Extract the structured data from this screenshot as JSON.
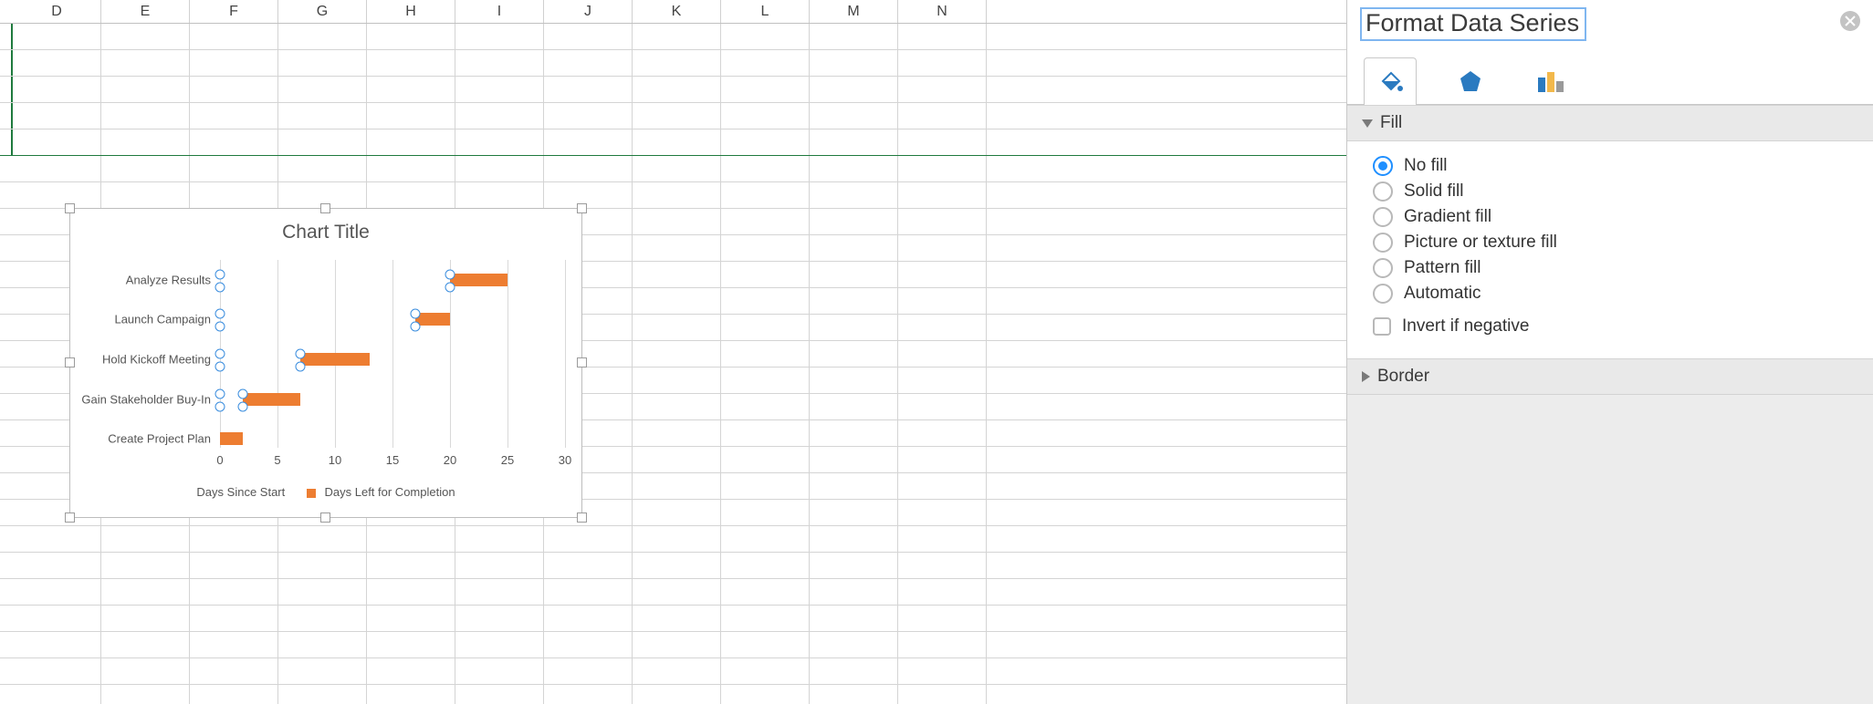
{
  "columns": [
    "D",
    "E",
    "F",
    "G",
    "H",
    "I",
    "J",
    "K",
    "L",
    "M",
    "N"
  ],
  "chart": {
    "title": "Chart Title",
    "legend": {
      "series1": "Days Since Start",
      "series2": "Days Left for Completion"
    },
    "x_ticks": [
      "0",
      "5",
      "10",
      "15",
      "20",
      "25",
      "30"
    ]
  },
  "chart_data": {
    "type": "bar",
    "orientation": "horizontal",
    "stacked": true,
    "title": "Chart Title",
    "xlabel": "",
    "ylabel": "",
    "xlim": [
      0,
      30
    ],
    "categories": [
      "Analyze Results",
      "Launch Campaign",
      "Hold Kickoff Meeting",
      "Gain Stakeholder Buy-In",
      "Create Project Plan"
    ],
    "series": [
      {
        "name": "Days Since Start",
        "values": [
          20,
          17,
          7,
          2,
          0
        ]
      },
      {
        "name": "Days Left for Completion",
        "values": [
          5,
          3,
          6,
          5,
          2
        ]
      }
    ],
    "colors": {
      "Days Since Start": "none",
      "Days Left for Completion": "#ED7D31"
    },
    "legend_position": "bottom"
  },
  "panel": {
    "title": "Format Data Series",
    "sections": {
      "fill": "Fill",
      "border": "Border"
    },
    "fill_options": {
      "no_fill": "No fill",
      "solid_fill": "Solid fill",
      "gradient_fill": "Gradient fill",
      "picture_fill": "Picture or texture fill",
      "pattern_fill": "Pattern fill",
      "automatic": "Automatic"
    },
    "fill_selected": "no_fill",
    "invert_label": "Invert if negative"
  }
}
